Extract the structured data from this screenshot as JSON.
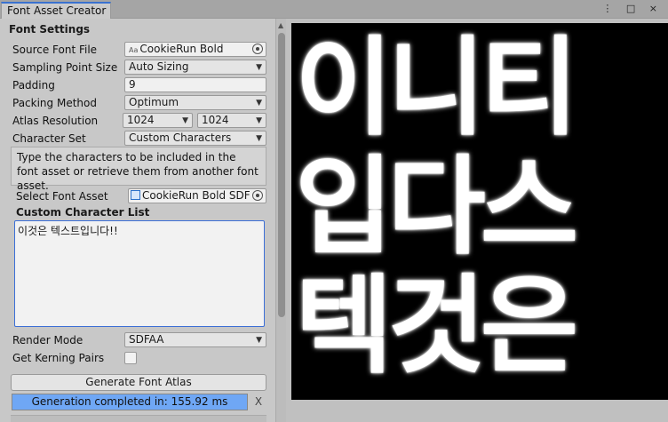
{
  "window": {
    "tab_title": "Font Asset Creator",
    "menu_icons": "⋮ □ ×"
  },
  "settings": {
    "section_title": "Font Settings",
    "source_font_file": {
      "label": "Source Font File",
      "icon": "Aa",
      "value": "CookieRun Bold"
    },
    "sampling_point_size": {
      "label": "Sampling Point Size",
      "value": "Auto Sizing"
    },
    "padding": {
      "label": "Padding",
      "value": "9"
    },
    "packing_method": {
      "label": "Packing Method",
      "value": "Optimum"
    },
    "atlas_resolution": {
      "label": "Atlas Resolution",
      "width": "1024",
      "height": "1024"
    },
    "character_set": {
      "label": "Character Set",
      "value": "Custom Characters"
    },
    "help_text": "Type the characters to be included in the font asset or retrieve them from another font asset.",
    "select_font_asset": {
      "label": "Select Font Asset",
      "value": "CookieRun Bold SDF"
    },
    "custom_character_list": {
      "label": "Custom Character List",
      "value": "이것은 텍스트입니다!!"
    },
    "render_mode": {
      "label": "Render Mode",
      "value": "SDFAA"
    },
    "get_kerning_pairs": {
      "label": "Get Kerning Pairs",
      "checked": false
    }
  },
  "actions": {
    "generate_button": "Generate Font Atlas",
    "progress_text": "Generation completed in: 155.92 ms",
    "progress": 1.0,
    "close_label": "X"
  },
  "atlas_preview": {
    "glyph_rows": [
      "이니티",
      "입다스",
      "텍것은"
    ]
  },
  "colors": {
    "accent": "#3a72d0",
    "progress": "#6fa7f5",
    "atlas_bg": "#000000"
  }
}
